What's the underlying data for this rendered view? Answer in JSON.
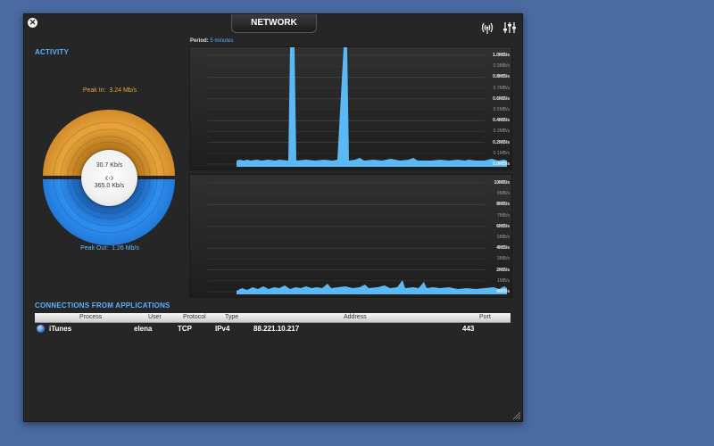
{
  "window": {
    "title": "NETWORK"
  },
  "activity": {
    "title": "ACTIVITY",
    "peak_in_label": "Peak In:",
    "peak_in_value": "3.24 Mb/s",
    "peak_out_label": "Peak Out:",
    "peak_out_value": "1.26 Mb/s",
    "rate_in": "30.7 Kb/s",
    "rate_out": "365.0 Kb/s",
    "in_color": "#e8a33a",
    "out_color": "#2d8ef0"
  },
  "graphs": {
    "period_label": "Period:",
    "period_value": "5 minutes",
    "top_ticks": [
      "1.0MB/s",
      "0.9MB/s",
      "0.8MB/s",
      "0.7MB/s",
      "0.6MB/s",
      "0.5MB/s",
      "0.4MB/s",
      "0.3MB/s",
      "0.2MB/s",
      "0.1MB/s",
      "0.0MB/s"
    ],
    "bottom_ticks": [
      "10MB/s",
      "9MB/s",
      "8MB/s",
      "7MB/s",
      "6MB/s",
      "5MB/s",
      "4MB/s",
      "3MB/s",
      "2MB/s",
      "1MB/s",
      "0MB/s"
    ],
    "line_color": "#5ab8f5"
  },
  "connections": {
    "title": "CONNECTIONS FROM APPLICATIONS",
    "columns": [
      "Process",
      "User",
      "Protocol",
      "Type",
      "Address",
      "Port"
    ],
    "rows": [
      {
        "process": "iTunes",
        "user": "elena",
        "protocol": "TCP",
        "type": "IPv4",
        "address": "88.221.10.217",
        "port": "443"
      }
    ]
  }
}
